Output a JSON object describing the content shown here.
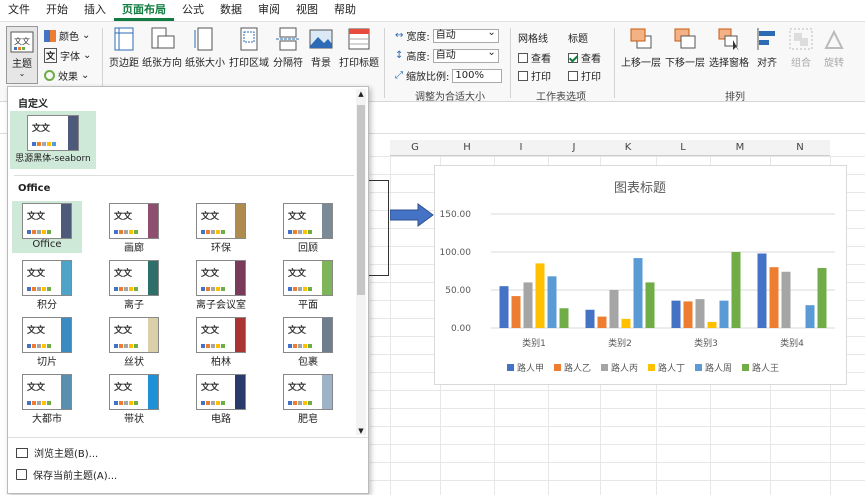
{
  "menu": {
    "tabs": [
      "文件",
      "开始",
      "插入",
      "页面布局",
      "公式",
      "数据",
      "审阅",
      "视图",
      "帮助"
    ],
    "active": "页面布局"
  },
  "ribbon": {
    "theme_label": "主题",
    "colors_label": "颜色",
    "fonts_label": "字体",
    "effects_label": "效果",
    "margins_label": "页边距",
    "orientation_label": "纸张方向",
    "size_label": "纸张大小",
    "print_area_label": "打印区域",
    "breaks_label": "分隔符",
    "background_label": "背景",
    "print_titles_label": "打印标题",
    "width_label": "宽度:",
    "width_value": "自动",
    "height_label": "高度:",
    "height_value": "自动",
    "scale_label": "缩放比例:",
    "scale_value": "100%",
    "fit_group_label": "调整为合适大小",
    "gridlines_label": "网格线",
    "headings_label": "标题",
    "view_label": "查看",
    "print_label": "打印",
    "sheet_options_label": "工作表选项",
    "bring_forward_label": "上移一层",
    "send_backward_label": "下移一层",
    "selection_pane_label": "选择窗格",
    "align_label": "对齐",
    "group_label": "组合",
    "rotate_label": "旋转",
    "arrange_label": "排列"
  },
  "columns": [
    "G",
    "H",
    "I",
    "J",
    "K",
    "L",
    "M",
    "N"
  ],
  "dropdown": {
    "custom_header": "自定义",
    "custom_theme": "思源黑体-seaborn",
    "office_header": "Office",
    "themes": [
      "Office",
      "画廊",
      "环保",
      "回顾",
      "积分",
      "离子",
      "离子会议室",
      "平面",
      "切片",
      "丝状",
      "柏林",
      "包裹",
      "大都市",
      "带状",
      "电路",
      "肥皂"
    ],
    "browse": "浏览主题(B)...",
    "save": "保存当前主题(A)..."
  },
  "chart_data": {
    "type": "bar",
    "title": "图表标题",
    "categories": [
      "类别1",
      "类别2",
      "类别3",
      "类别4"
    ],
    "ylim": [
      0,
      150
    ],
    "yticks": [
      "0.00",
      "50.00",
      "100.00",
      "150.00"
    ],
    "grid": true,
    "legend": "bottom",
    "series": [
      {
        "name": "路人甲",
        "color": "#4472c4",
        "values": [
          55,
          24,
          36,
          98
        ]
      },
      {
        "name": "路人乙",
        "color": "#ed7d31",
        "values": [
          42,
          15,
          35,
          80
        ]
      },
      {
        "name": "路人丙",
        "color": "#a5a5a5",
        "values": [
          60,
          50,
          38,
          74
        ]
      },
      {
        "name": "路人丁",
        "color": "#ffc000",
        "values": [
          85,
          12,
          8,
          0
        ]
      },
      {
        "name": "路人周",
        "color": "#5b9bd5",
        "values": [
          68,
          92,
          36,
          30
        ]
      },
      {
        "name": "路人王",
        "color": "#70ad47",
        "values": [
          26,
          60,
          100,
          79
        ]
      }
    ]
  }
}
